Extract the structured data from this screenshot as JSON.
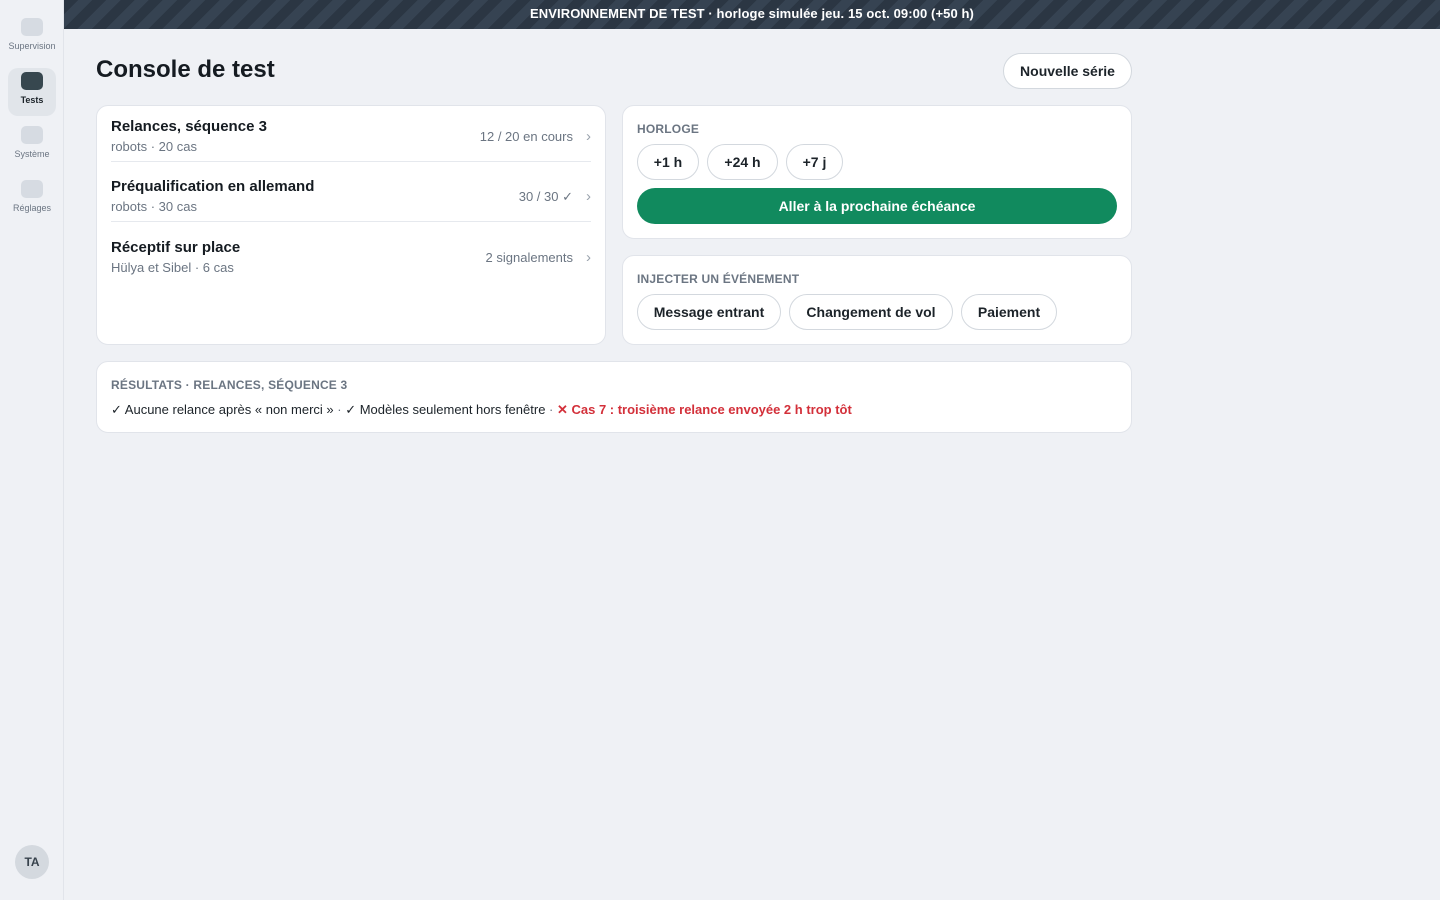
{
  "banner": {
    "text": "ENVIRONNEMENT DE TEST · horloge simulée jeu. 15 oct. 09:00 (+50 h)"
  },
  "sidebar": {
    "items": [
      {
        "label": "Supervision",
        "icon": "supervision-icon",
        "active": false
      },
      {
        "label": "Tests",
        "icon": "tests-icon",
        "active": true
      },
      {
        "label": "Système",
        "icon": "system-icon",
        "active": false
      },
      {
        "label": "Réglages",
        "icon": "settings-icon",
        "active": false
      }
    ],
    "avatar": "TA"
  },
  "header": {
    "title": "Console de test",
    "new_series_label": "Nouvelle série"
  },
  "series": [
    {
      "name": "Relances, séquence 3",
      "meta": "robots · 20 cas",
      "status": "12 / 20 en cours"
    },
    {
      "name": "Préqualification en allemand",
      "meta": "robots · 30 cas",
      "status": "30 / 30 ✓"
    },
    {
      "name": "Réceptif sur place",
      "meta": "Hülya et Sibel · 6 cas",
      "status": "2 signalements"
    }
  ],
  "clock": {
    "label": "HORLOGE",
    "steps": [
      "+1 h",
      "+24 h",
      "+7 j"
    ],
    "next_deadline_label": "Aller à la prochaine échéance"
  },
  "inject": {
    "label": "INJECTER UN ÉVÉNEMENT",
    "events": [
      "Message entrant",
      "Changement de vol",
      "Paiement"
    ]
  },
  "results": {
    "label": "RÉSULTATS · RELANCES, SÉQUENCE 3",
    "pass_1": "✓ Aucune relance après « non merci »",
    "pass_2": "✓ Modèles seulement hors fenêtre",
    "separator": " · ",
    "fail_1": "✕ Cas 7 : troisième relance envoyée 2 h trop tôt"
  },
  "colors": {
    "accent_green": "#118a5e",
    "error_red": "#d3303a",
    "banner_dark": "#2b3643"
  }
}
